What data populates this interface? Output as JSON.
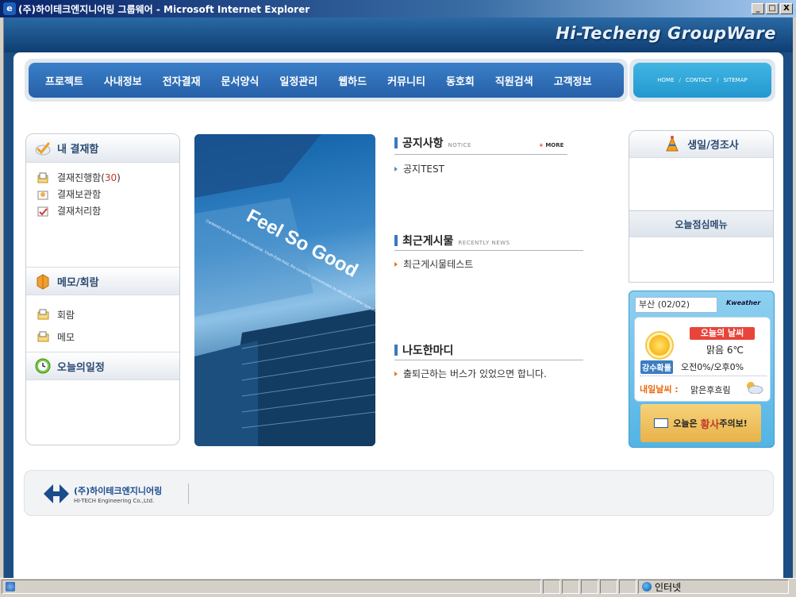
{
  "window": {
    "title": "(주)하이테크엔지니어링 그룹웨어 - Microsoft Internet Explorer",
    "minimize": "_",
    "maximize": "□",
    "close": "X"
  },
  "brand": "Hi-Techeng  GroupWare",
  "nav": {
    "items": [
      "프로젝트",
      "사내정보",
      "전자결재",
      "문서양식",
      "일정관리",
      "웹하드",
      "커뮤니티",
      "동호회",
      "직원검색",
      "고객정보"
    ],
    "util_links": [
      "HOME",
      "CONTACT",
      "SITEMAP"
    ],
    "util_sep": "/"
  },
  "left_panel": {
    "approval_title": "내 결재함",
    "approval_items": [
      {
        "label": "결재진행함",
        "count": "30"
      },
      {
        "label": "결재보관함"
      },
      {
        "label": "결재처리함"
      }
    ],
    "memo_title": "메모/회람",
    "memo_items": [
      "회람",
      "메모"
    ],
    "schedule_title": "오늘의일정"
  },
  "hero": {
    "headline": "Feel So Good",
    "fine_print": "Centered on the areas like Industrial, Youth East Asia, the company concentrates its efforts on it other type products produced in the Middle East. It is also"
  },
  "notice": {
    "title": "공지사항",
    "sub": "NOTICE",
    "more_plus": "+",
    "more": "MORE",
    "items": [
      "공지TEST"
    ]
  },
  "recent": {
    "title": "최근게시물",
    "sub": "RECENTLY NEWS",
    "items": [
      "최근게시물테스트"
    ]
  },
  "nado": {
    "title": "나도한마디",
    "items": [
      "출퇴근하는 버스가 있었으면 합니다."
    ]
  },
  "right_panel": {
    "birthday_title": "생일/경조사",
    "lunch_title": "오늘점심메뉴"
  },
  "weather": {
    "city": "부산 (02/02)",
    "provider": "Kweather",
    "today_label": "오늘의 날씨",
    "today": "맑음 6℃",
    "rain_label": "강수확률",
    "rain": "오전0%/오후0%",
    "tomorrow_label": "내일날씨 :",
    "tomorrow": "맑은후흐림",
    "banner_pre": "오늘은",
    "banner_hl": "황사",
    "banner_post": "주의보!"
  },
  "footer": {
    "company": "(주)하이테크엔지니어링",
    "company_en": "HI-TECH Engineering Co.,Ltd."
  },
  "status": {
    "zone": "인터넷",
    "ie_icon": "e"
  },
  "colors": {
    "nav": "#2f6fb8",
    "util": "#2aa4d8",
    "accent_red": "#e8443a",
    "section_bar": "#3b79bd"
  }
}
